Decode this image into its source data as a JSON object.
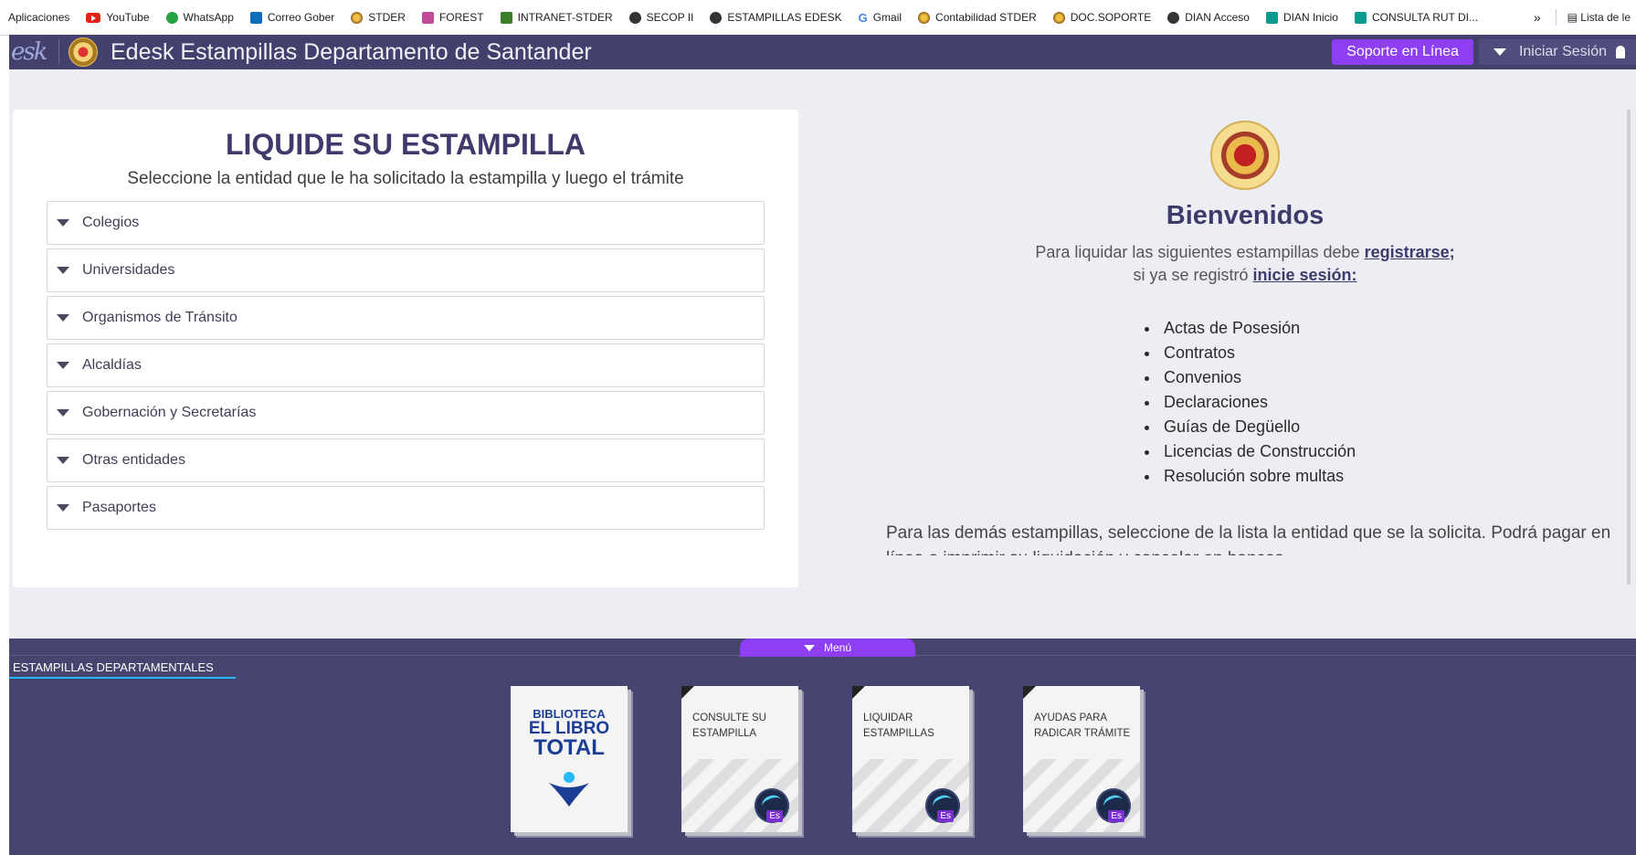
{
  "bookmarks": {
    "items": [
      {
        "label": "Aplicaciones",
        "icon": "apps-icon"
      },
      {
        "label": "YouTube",
        "icon": "youtube-icon"
      },
      {
        "label": "WhatsApp",
        "icon": "whatsapp-icon"
      },
      {
        "label": "Correo Gober",
        "icon": "outlook-icon"
      },
      {
        "label": "STDER",
        "icon": "seal-icon"
      },
      {
        "label": "FOREST",
        "icon": "forest-icon"
      },
      {
        "label": "INTRANET-STDER",
        "icon": "intranet-icon"
      },
      {
        "label": "SECOP II",
        "icon": "globe-icon"
      },
      {
        "label": "ESTAMPILLAS EDESK",
        "icon": "globe-icon"
      },
      {
        "label": "Gmail",
        "icon": "google-icon"
      },
      {
        "label": "Contabilidad STDER",
        "icon": "seal-icon"
      },
      {
        "label": "DOC.SOPORTE",
        "icon": "seal-icon"
      },
      {
        "label": "DIAN Acceso",
        "icon": "globe-icon"
      },
      {
        "label": "DIAN Inicio",
        "icon": "teal-doc-icon"
      },
      {
        "label": "CONSULTA RUT DI...",
        "icon": "teal-doc-icon"
      }
    ],
    "more": "»",
    "reading_list": "Lista de le"
  },
  "header": {
    "logo": "esk",
    "title": "Edesk Estampillas Departamento de Santander",
    "support_button": "Soporte en Línea",
    "login_button": "Iniciar Sesión"
  },
  "left_card": {
    "title": "LIQUIDE SU ESTAMPILLA",
    "subtitle": "Seleccione la entidad que le ha solicitado la estampilla y luego el trámite",
    "accordion": [
      "Colegios",
      "Universidades",
      "Organismos de Tránsito",
      "Alcaldías",
      "Gobernación y Secretarías",
      "Otras entidades",
      "Pasaportes"
    ]
  },
  "welcome": {
    "title": "Bienvenidos",
    "line1_prefix": "Para liquidar las siguientes estampillas debe ",
    "line1_link": "registrarse;",
    "line2_prefix": "si ya se registró ",
    "line2_link": "inicie sesión:",
    "list": [
      "Actas de Posesión",
      "Contratos",
      "Convenios",
      "Declaraciones",
      "Guías de Degüello",
      "Licencias de Construcción",
      "Resolución sobre multas"
    ],
    "footer": "Para las demás estampillas, seleccione de la lista la entidad que se la solicita. Podrá pagar en línea o imprimir su liquidación y cancelar en bancos."
  },
  "bottom": {
    "menu_label": "Menú",
    "section_label": "ESTAMPILLAS DEPARTAMENTALES",
    "library_tile": {
      "line1": "BIBLIOTECA",
      "line2": "EL LIBRO",
      "line3": "TOTAL"
    },
    "tiles": [
      {
        "line1": "CONSULTE SU",
        "line2": "ESTAMPILLA"
      },
      {
        "line1": "LIQUIDAR",
        "line2": "ESTAMPILLAS"
      },
      {
        "line1": "AYUDAS PARA",
        "line2": "RADICAR TRÁMITE"
      }
    ],
    "tile_badge": "Es"
  },
  "colors": {
    "header_bg": "#43406d",
    "accent_purple": "#8e3ff5",
    "title_navy": "#3e3a6c",
    "bottom_bg": "#47456f",
    "underline_blue": "#27b9ff"
  }
}
